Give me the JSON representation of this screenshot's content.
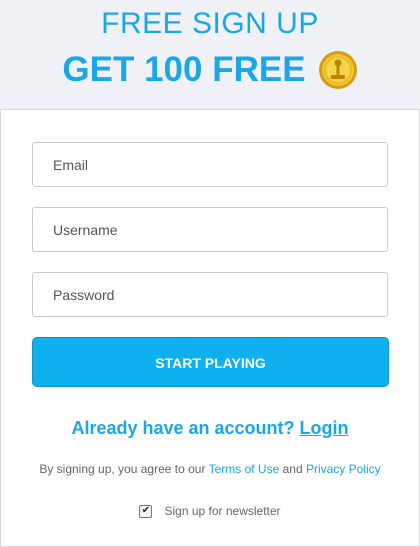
{
  "header": {
    "subtitle": "FREE SIGN UP",
    "title": "GET 100 FREE",
    "coin_icon": "coin-icon"
  },
  "form": {
    "email_placeholder": "Email",
    "username_placeholder": "Username",
    "password_placeholder": "Password",
    "submit_label": "START PLAYING"
  },
  "account": {
    "prompt": "Already have an account?",
    "login_link": "Login"
  },
  "terms": {
    "prefix": "By signing up, you agree to our",
    "terms_link": "Terms of Use",
    "conjunction": "and",
    "privacy_link": "Privacy Policy"
  },
  "newsletter": {
    "label": "Sign up for newsletter",
    "checked": true
  },
  "colors": {
    "accent": "#1aa7e8",
    "button": "#0eb0f0",
    "background": "#f0f1f6"
  }
}
